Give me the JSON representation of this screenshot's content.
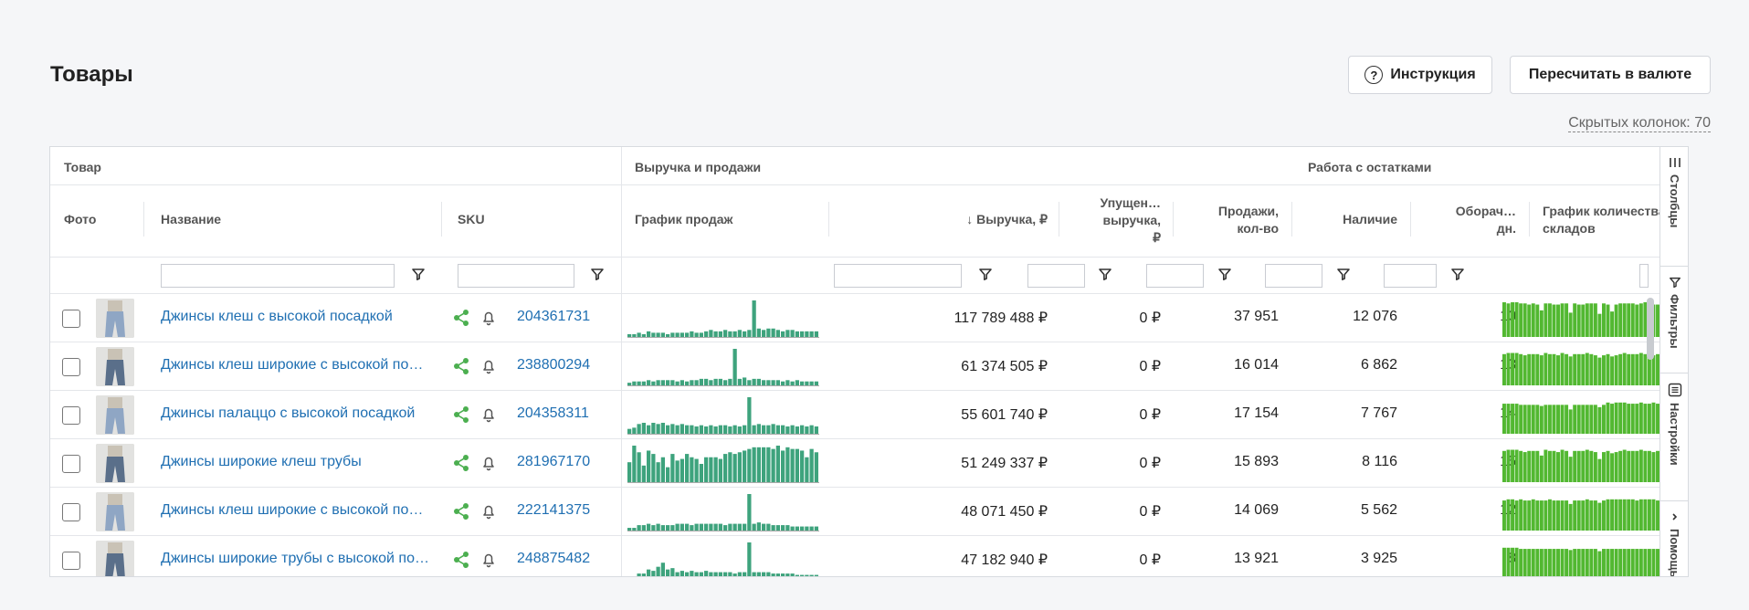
{
  "page": {
    "title": "Товары"
  },
  "toolbar": {
    "instruction_label": "Инструкция",
    "instruction_icon": "help-circle-icon",
    "recalc_label": "Пересчитать в валюте",
    "hidden_columns": "Скрытых колонок: 70"
  },
  "groups": {
    "product": "Товар",
    "revenue": "Выручка и продажи",
    "stock": "Работа с остатками"
  },
  "columns": {
    "photo": "Фото",
    "name": "Название",
    "sku": "SKU",
    "sales_chart": "График продаж",
    "revenue": "↓ Выручка, ₽",
    "lost_revenue_1": "Упущен…",
    "lost_revenue_2": "выручка,",
    "lost_revenue_3": "₽",
    "sales_1": "Продажи,",
    "sales_2": "кол-во",
    "stock": "Наличие",
    "turnover_1": "Оборач…",
    "turnover_2": "дн.",
    "wh_chart_1": "График количества",
    "wh_chart_2": "складов"
  },
  "sidebar": {
    "columns": "Столбцы",
    "filters": "Фильтры",
    "settings": "Настройки",
    "help": "Помощь"
  },
  "colors": {
    "link": "#1f6fb2",
    "sales_bar": "#3ea37d",
    "stock_bar": "#52b831",
    "share": "#4caf50"
  },
  "rows": [
    {
      "name": "Джинсы клеш с высокой посадкой",
      "sku": "204361731",
      "revenue": "117 789 488 ₽",
      "lost": "0 ₽",
      "sales": "37 951",
      "stock": "12 076",
      "turnover": "10",
      "sales_series": [
        2,
        2,
        3,
        2,
        4,
        3,
        3,
        3,
        2,
        3,
        3,
        3,
        3,
        4,
        3,
        3,
        4,
        5,
        4,
        4,
        5,
        4,
        4,
        5,
        4,
        5,
        26,
        6,
        5,
        6,
        6,
        5,
        4,
        5,
        5,
        4,
        4,
        4,
        4,
        4
      ],
      "stock_series": [
        30,
        29,
        30,
        30,
        29,
        29,
        28,
        29,
        28,
        23,
        29,
        29,
        28,
        28,
        29,
        29,
        21,
        29,
        28,
        28,
        29,
        29,
        29,
        20,
        29,
        28,
        22,
        28,
        29,
        29,
        29,
        29,
        28,
        29,
        30,
        29,
        28,
        28,
        29,
        30,
        29,
        29,
        29,
        28,
        29,
        30,
        29,
        30
      ]
    },
    {
      "name": "Джинсы клеш широкие с высокой посадкой",
      "sku": "238800294",
      "revenue": "61 374 505 ₽",
      "lost": "0 ₽",
      "sales": "16 014",
      "stock": "6 862",
      "turnover": "13",
      "sales_series": [
        2,
        3,
        3,
        3,
        4,
        3,
        4,
        4,
        4,
        4,
        3,
        4,
        3,
        4,
        4,
        5,
        5,
        4,
        5,
        5,
        4,
        5,
        28,
        5,
        6,
        4,
        5,
        5,
        4,
        4,
        4,
        4,
        3,
        4,
        3,
        4,
        3,
        3,
        3,
        3
      ],
      "stock_series": [
        27,
        28,
        28,
        28,
        27,
        26,
        27,
        27,
        27,
        26,
        28,
        27,
        27,
        26,
        28,
        27,
        25,
        27,
        27,
        27,
        28,
        27,
        26,
        24,
        26,
        27,
        25,
        26,
        27,
        28,
        27,
        27,
        27,
        28,
        27,
        27,
        26,
        27,
        27,
        27,
        27,
        26,
        27,
        27,
        27,
        27,
        27,
        28
      ]
    },
    {
      "name": "Джинсы палаццо с высокой посадкой",
      "sku": "204358311",
      "revenue": "55 601 740 ₽",
      "lost": "0 ₽",
      "sales": "17 154",
      "stock": "7 767",
      "turnover": "14",
      "sales_series": [
        4,
        5,
        8,
        9,
        7,
        9,
        8,
        9,
        7,
        8,
        7,
        8,
        7,
        7,
        6,
        7,
        6,
        7,
        6,
        7,
        7,
        6,
        7,
        6,
        7,
        30,
        7,
        8,
        7,
        7,
        8,
        7,
        7,
        6,
        7,
        6,
        7,
        6,
        7,
        6
      ],
      "stock_series": [
        26,
        26,
        26,
        26,
        25,
        25,
        25,
        25,
        25,
        24,
        25,
        25,
        25,
        25,
        25,
        25,
        21,
        25,
        25,
        25,
        25,
        25,
        25,
        23,
        25,
        27,
        26,
        27,
        27,
        27,
        26,
        26,
        26,
        27,
        26,
        26,
        27,
        26,
        26,
        27,
        27,
        27,
        26,
        26,
        26,
        27,
        27,
        26
      ]
    },
    {
      "name": "Джинсы широкие клеш трубы",
      "sku": "281967170",
      "revenue": "51 249 337 ₽",
      "lost": "0 ₽",
      "sales": "15 893",
      "stock": "8 116",
      "turnover": "15",
      "sales_series": [
        12,
        22,
        18,
        10,
        19,
        17,
        12,
        15,
        9,
        17,
        13,
        14,
        17,
        15,
        14,
        11,
        15,
        15,
        15,
        14,
        17,
        18,
        17,
        18,
        19,
        20,
        21,
        21,
        21,
        21,
        20,
        22,
        19,
        21,
        20,
        20,
        19,
        15,
        20,
        18
      ],
      "stock_series": [
        27,
        28,
        28,
        28,
        27,
        26,
        27,
        27,
        27,
        23,
        28,
        27,
        27,
        26,
        28,
        27,
        22,
        27,
        27,
        27,
        28,
        27,
        26,
        20,
        26,
        27,
        25,
        26,
        27,
        28,
        27,
        27,
        27,
        28,
        27,
        27,
        26,
        27,
        27,
        27,
        27,
        26,
        27,
        27,
        27,
        27,
        27,
        28
      ]
    },
    {
      "name": "Джинсы клеш широкие с высокой посадкой",
      "sku": "222141375",
      "revenue": "48 071 450 ₽",
      "lost": "0 ₽",
      "sales": "14 069",
      "stock": "5 562",
      "turnover": "12",
      "sales_series": [
        2,
        2,
        4,
        4,
        5,
        4,
        5,
        4,
        4,
        4,
        5,
        5,
        5,
        4,
        5,
        5,
        5,
        5,
        5,
        5,
        4,
        5,
        5,
        5,
        5,
        27,
        5,
        6,
        5,
        5,
        4,
        4,
        4,
        4,
        3,
        3,
        3,
        3,
        3,
        3
      ],
      "stock_series": [
        26,
        27,
        27,
        26,
        27,
        26,
        26,
        27,
        26,
        26,
        26,
        27,
        26,
        26,
        26,
        26,
        23,
        26,
        26,
        26,
        27,
        26,
        26,
        24,
        26,
        27,
        27,
        27,
        27,
        27,
        27,
        27,
        26,
        27,
        27,
        27,
        27,
        26,
        27,
        27,
        27,
        27,
        26,
        26,
        26,
        27,
        27,
        26
      ]
    },
    {
      "name": "Джинсы широкие трубы с высокой посадкой",
      "sku": "248875482",
      "revenue": "47 182 940 ₽",
      "lost": "0 ₽",
      "sales": "13 921",
      "stock": "3 925",
      "turnover": "8",
      "sales_series": [
        2,
        2,
        4,
        4,
        7,
        6,
        9,
        12,
        7,
        8,
        5,
        6,
        5,
        6,
        5,
        5,
        6,
        5,
        5,
        5,
        5,
        5,
        4,
        5,
        5,
        27,
        5,
        5,
        5,
        5,
        4,
        4,
        4,
        4,
        4,
        3,
        3,
        3,
        3,
        3
      ],
      "stock_series": [
        27,
        27,
        27,
        27,
        26,
        26,
        26,
        26,
        26,
        26,
        26,
        26,
        26,
        26,
        26,
        26,
        25,
        26,
        26,
        26,
        26,
        26,
        26,
        24,
        26,
        26,
        26,
        26,
        26,
        26,
        26,
        26,
        26,
        26,
        26,
        26,
        26,
        26,
        26,
        26,
        26,
        26,
        26,
        26,
        26,
        26,
        26,
        26
      ]
    }
  ]
}
